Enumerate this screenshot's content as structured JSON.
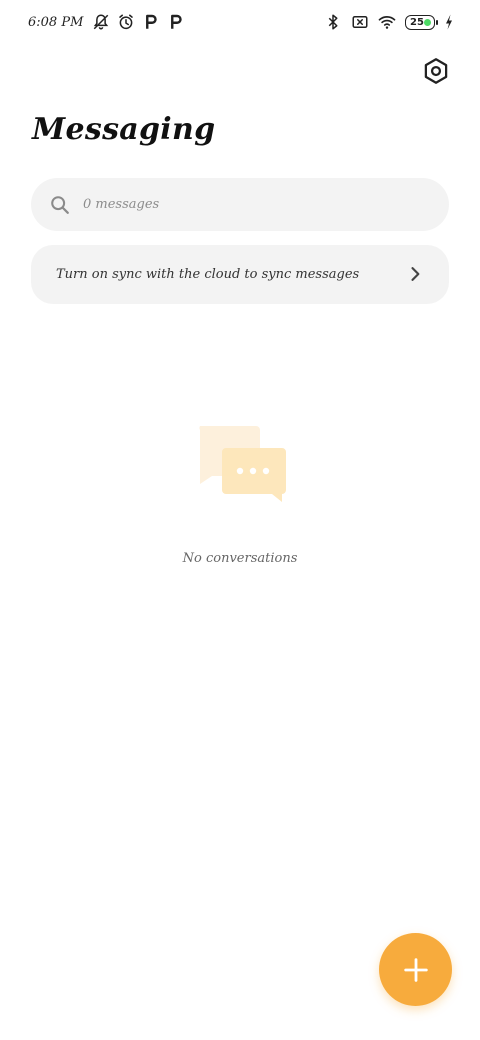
{
  "status_bar": {
    "time": "6:08 PM",
    "left_icons": [
      "bell-muted-icon",
      "alarm-icon",
      "p-app-icon",
      "p-app-icon"
    ],
    "right_icons": [
      "bluetooth-icon",
      "sim-off-icon",
      "wifi-icon"
    ],
    "battery_level": "25",
    "battery_accent": "#4cd964",
    "charging_icon": "bolt-icon"
  },
  "header": {
    "settings_icon": "settings-hex-icon",
    "title": "Messaging"
  },
  "search": {
    "placeholder": "0 messages",
    "icon": "search-icon"
  },
  "sync_banner": {
    "text": "Turn on sync with the cloud to sync messages",
    "icon": "chevron-right-icon"
  },
  "empty_state": {
    "icon": "chat-bubbles-icon",
    "text": "No conversations"
  },
  "fab": {
    "icon": "plus-icon",
    "color": "#f7ab3d"
  }
}
